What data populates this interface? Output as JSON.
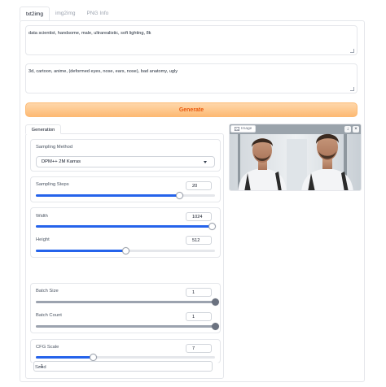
{
  "tabs": [
    {
      "label": "txt2img",
      "active": true
    },
    {
      "label": "img2img",
      "active": false
    },
    {
      "label": "PNG Info",
      "active": false
    }
  ],
  "prompt": {
    "value": "data scientist, handsome, male, ultrarealistic, soft lighting, 8k"
  },
  "negative_prompt": {
    "value": "3d, cartoon, anime, (deformed eyes, nose, ears, nose), bad anatomy, ugly"
  },
  "generate_label": "Generate",
  "settings_tab_label": "Generation",
  "sampling": {
    "label": "Sampling Method",
    "value": "DPM++ 2M Karras"
  },
  "steps": {
    "label": "Sampling Steps",
    "value": "20",
    "fraction": 0.8
  },
  "width": {
    "label": "Width",
    "value": "1024",
    "fraction": 0.98
  },
  "height": {
    "label": "Height",
    "value": "512",
    "fraction": 0.5
  },
  "batch_size": {
    "label": "Batch Size",
    "value": "1",
    "fraction": 1.0
  },
  "batch_count": {
    "label": "Batch Count",
    "value": "1",
    "fraction": 1.0
  },
  "cfg": {
    "label": "CFG Scale",
    "value": "7",
    "fraction": 0.32
  },
  "seed": {
    "label": "Seed",
    "value": "-1"
  },
  "image_panel": {
    "label": "Image",
    "icon": "image-icon",
    "actions": [
      "download-icon",
      "close-icon"
    ]
  },
  "colors": {
    "accent": "#2563eb",
    "generate_text": "#ea580c",
    "generate_bg": "#fdba74"
  }
}
